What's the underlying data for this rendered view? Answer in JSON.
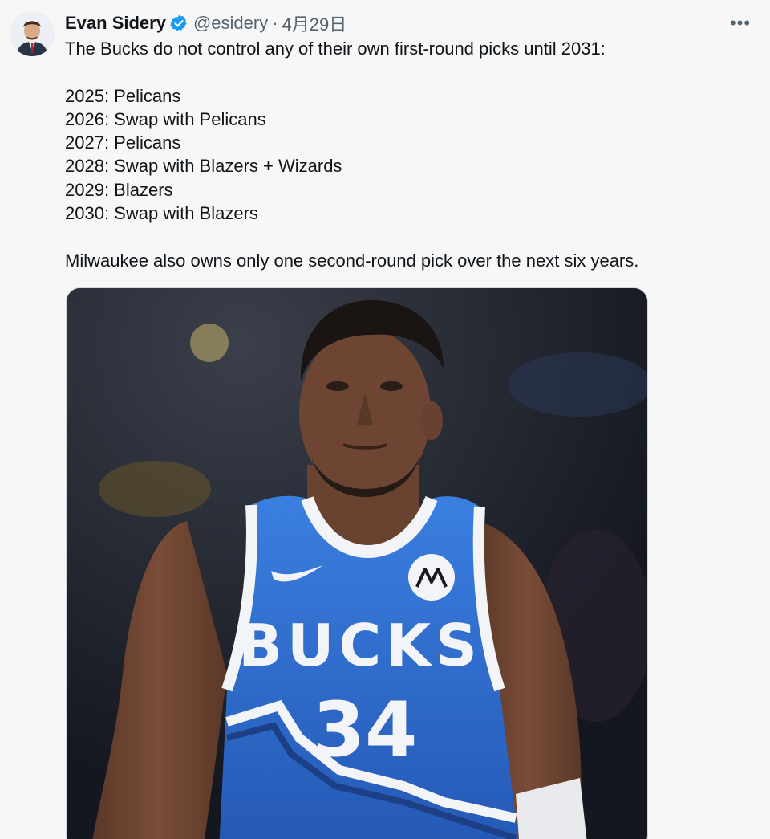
{
  "tweet": {
    "author": {
      "display_name": "Evan Sidery",
      "handle": "@esidery",
      "verified_icon": "verified-badge-icon",
      "avatar_icon": "user-avatar"
    },
    "separator": "·",
    "timestamp": "4月29日",
    "more_icon": "more-icon",
    "more_label": "•••",
    "text": {
      "intro": "The Bucks do not control any of their own first-round picks until 2031:",
      "picks": [
        "2025: Pelicans",
        "2026: Swap with Pelicans",
        "2027: Pelicans",
        "2028: Swap with Blazers + Wizards",
        "2029: Blazers",
        "2030: Swap with Blazers"
      ],
      "outro": "Milwaukee also owns only one second-round pick over the next six years."
    },
    "media": {
      "jersey_wordmark": "BUCKS",
      "jersey_number": "34",
      "colors": {
        "jersey_blue": "#2f6fd1",
        "trim_white": "#f2f4f8",
        "background_dark": "#1a1f2a",
        "skin": "#6b4332"
      }
    }
  },
  "colors": {
    "verified_blue": "#1d9bf0",
    "secondary_text": "#536471",
    "primary_text": "#0f1419"
  }
}
